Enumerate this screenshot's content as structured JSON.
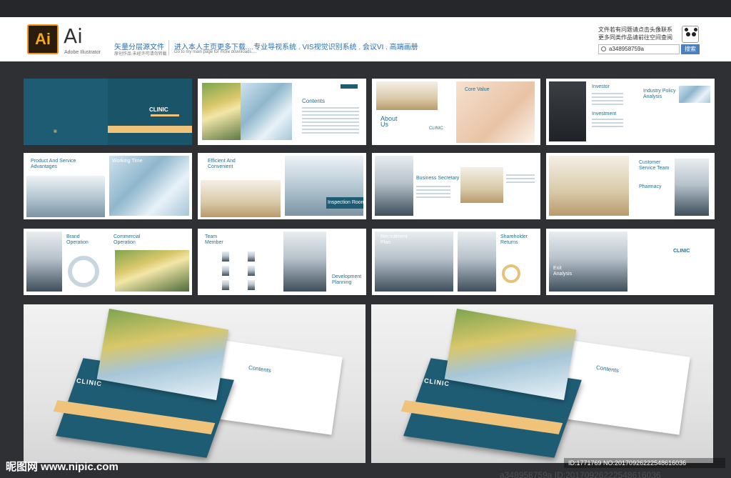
{
  "header": {
    "ai_logo": "Ai",
    "ai_title": "Ai",
    "ai_subtitle": "Adobe Illustrator",
    "source_title": "矢量分层源文件",
    "source_sub": "原创作品 未经许可请勿转载",
    "promo_title": "进入本人主页更多下载....专业导视系统 . VIS视觉识别系统 . 会议VI . 高端画册",
    "promo_sub": "Go to my main page for more downloads....",
    "contact_line1": "文件若有问题请点击头像联系",
    "contact_line2": "更多同类作品请前往空间查阅",
    "search_value": "a348958759a",
    "search_button": "搜索"
  },
  "spreads": {
    "r1": {
      "s1_clinic": "CLINIC",
      "s2_contents": "Contents",
      "s3_about": "About\nUs",
      "s3_core": "Core Value",
      "s3_clinic": "CLINIC",
      "s4_investor": "Investor",
      "s4_investment": "Investment",
      "s4_industry": "Industry Policy\nAnalysis"
    },
    "r2": {
      "s1_product": "Product And Service\nAdvantages",
      "s1_working": "Working Time",
      "s2_efficient": "Efficient And\nConvenient",
      "s2_inspection": "Inspection Room",
      "s3_secretary": "Business Secretary",
      "s4_customer": "Customer\nService Team",
      "s4_pharmacy": "Pharmacy"
    },
    "r3": {
      "s1_brand": "Brand\nOperation",
      "s1_commercial": "Commercial\nOperation",
      "s2_team": "Team\nMember",
      "s2_development": "Development\nPlanning",
      "s3_recruitment": "Recruitment\nPlan",
      "s3_shareholder": "Shareholder\nReturns",
      "s4_exit": "Exit\nAnalysis",
      "s4_clinic": "CLINIC"
    }
  },
  "mockups": {
    "cover_clinic": "CLINIC",
    "contents": "Contents"
  },
  "footer": {
    "watermark": "昵图网 www.nipic.com",
    "id_text": "ID:1771769 NO:20170926222548616036",
    "faint_text": "a348958759a  ID:20170926222548616036"
  },
  "colors": {
    "teal": "#1e5c74",
    "gold": "#f0c37a",
    "background": "#2f3034"
  }
}
